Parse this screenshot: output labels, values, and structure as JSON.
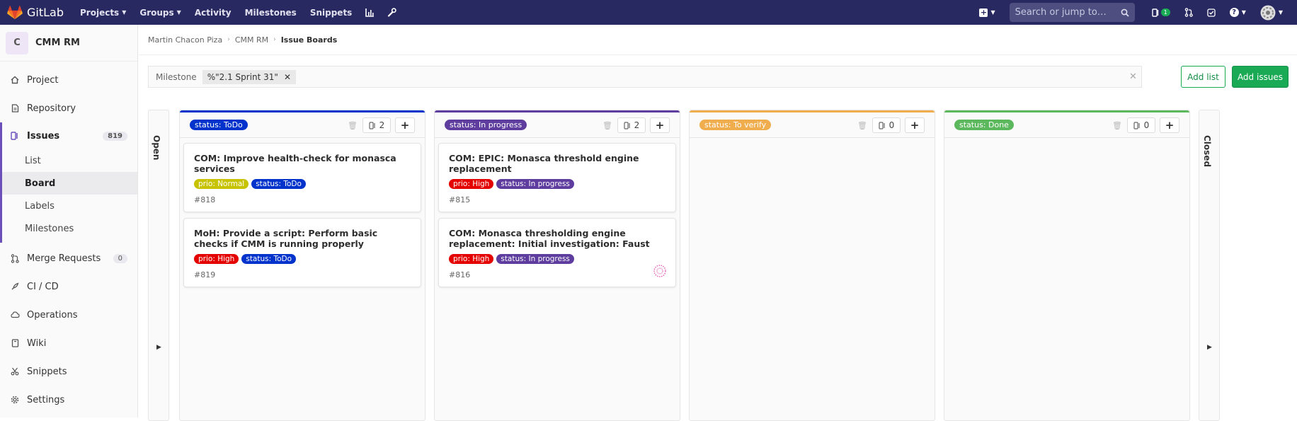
{
  "topbar": {
    "brand": "GitLab",
    "nav": [
      {
        "label": "Projects",
        "dropdown": true
      },
      {
        "label": "Groups",
        "dropdown": true
      },
      {
        "label": "Activity",
        "dropdown": false
      },
      {
        "label": "Milestones",
        "dropdown": false
      },
      {
        "label": "Snippets",
        "dropdown": false
      }
    ],
    "search_placeholder": "Search or jump to…",
    "todo_count": "1",
    "colors": {
      "bar": "#292961",
      "search": "#4e4e80"
    }
  },
  "sidebar": {
    "project_initial": "C",
    "project_name": "CMM RM",
    "items": [
      {
        "label": "Project",
        "icon": "home-icon"
      },
      {
        "label": "Repository",
        "icon": "file-icon"
      },
      {
        "label": "Issues",
        "icon": "issues-icon",
        "badge": "819"
      },
      {
        "label": "Merge Requests",
        "icon": "merge-request-icon",
        "badge": "0"
      },
      {
        "label": "CI / CD",
        "icon": "rocket-icon"
      },
      {
        "label": "Operations",
        "icon": "cloud-gear-icon"
      },
      {
        "label": "Wiki",
        "icon": "book-icon"
      },
      {
        "label": "Snippets",
        "icon": "scissors-icon"
      },
      {
        "label": "Settings",
        "icon": "gear-icon"
      }
    ],
    "issues_sub": [
      "List",
      "Board",
      "Labels",
      "Milestones"
    ]
  },
  "breadcrumb": [
    "Martin Chacon Piza",
    "CMM RM",
    "Issue Boards"
  ],
  "filter": {
    "token_name": "Milestone",
    "token_value": "%\"2.1 Sprint 31\""
  },
  "buttons": {
    "add_list": "Add list",
    "add_issues": "Add issues"
  },
  "board": {
    "open_label": "Open",
    "closed_label": "Closed",
    "lists": [
      {
        "label": "status: ToDo",
        "color": "#0033cc",
        "count": "2",
        "cards": [
          {
            "title": "COM: Improve health-check for monasca services",
            "number": "#818",
            "labels": [
              {
                "text": "prio: Normal",
                "color": "#c7c300"
              },
              {
                "text": "status: ToDo",
                "color": "#0033cc"
              }
            ]
          },
          {
            "title": "MoH: Provide a script: Perform basic checks if CMM is running properly",
            "number": "#819",
            "labels": [
              {
                "text": "prio: High",
                "color": "#e50000"
              },
              {
                "text": "status: ToDo",
                "color": "#0033cc"
              }
            ]
          }
        ]
      },
      {
        "label": "status: In progress",
        "color": "#5e3d9e",
        "count": "2",
        "cards": [
          {
            "title": "COM: EPIC: Monasca threshold engine replacement",
            "number": "#815",
            "labels": [
              {
                "text": "prio: High",
                "color": "#e50000"
              },
              {
                "text": "status: In progress",
                "color": "#5e3d9e"
              }
            ]
          },
          {
            "title": "COM: Monasca thresholding engine replacement: Initial investigation: Faust",
            "number": "#816",
            "labels": [
              {
                "text": "prio: High",
                "color": "#e50000"
              },
              {
                "text": "status: In progress",
                "color": "#5e3d9e"
              }
            ],
            "assignee": true
          }
        ]
      },
      {
        "label": "status: To verify",
        "color": "#f0ad4e",
        "count": "0",
        "cards": []
      },
      {
        "label": "status: Done",
        "color": "#5cb85c",
        "count": "0",
        "cards": []
      }
    ]
  }
}
